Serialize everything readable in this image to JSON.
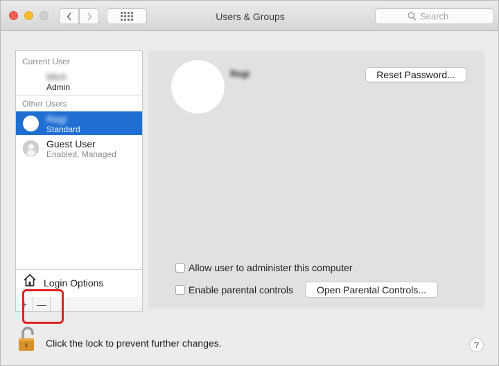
{
  "window": {
    "title": "Users & Groups"
  },
  "search": {
    "placeholder": "Search"
  },
  "sidebar": {
    "current_user_label": "Current User",
    "current_user": {
      "name": "Mich",
      "role": "Admin"
    },
    "other_users_label": "Other Users",
    "other_users": [
      {
        "name": "Regi",
        "role": "Standard",
        "selected": true
      },
      {
        "name": "Guest User",
        "role": "Enabled, Managed",
        "selected": false
      }
    ],
    "login_options_label": "Login Options",
    "add_label": "+",
    "remove_label": "—"
  },
  "main": {
    "user_name": "Regi",
    "reset_password_label": "Reset Password...",
    "allow_admin_label": "Allow user to administer this computer",
    "parental_controls_label": "Enable parental controls",
    "open_parental_label": "Open Parental Controls..."
  },
  "footer": {
    "lock_label": "Click the lock to prevent further changes.",
    "help_label": "?"
  },
  "colors": {
    "selection": "#1f6fd3",
    "highlight": "#e0231e",
    "lock": "#d8902a"
  },
  "icons": {
    "back": "chevron-left-icon",
    "forward": "chevron-right-icon",
    "grid": "grid-icon",
    "search": "magnifier-icon",
    "home": "house-icon",
    "lock": "padlock-open-icon",
    "guest": "person-icon"
  }
}
